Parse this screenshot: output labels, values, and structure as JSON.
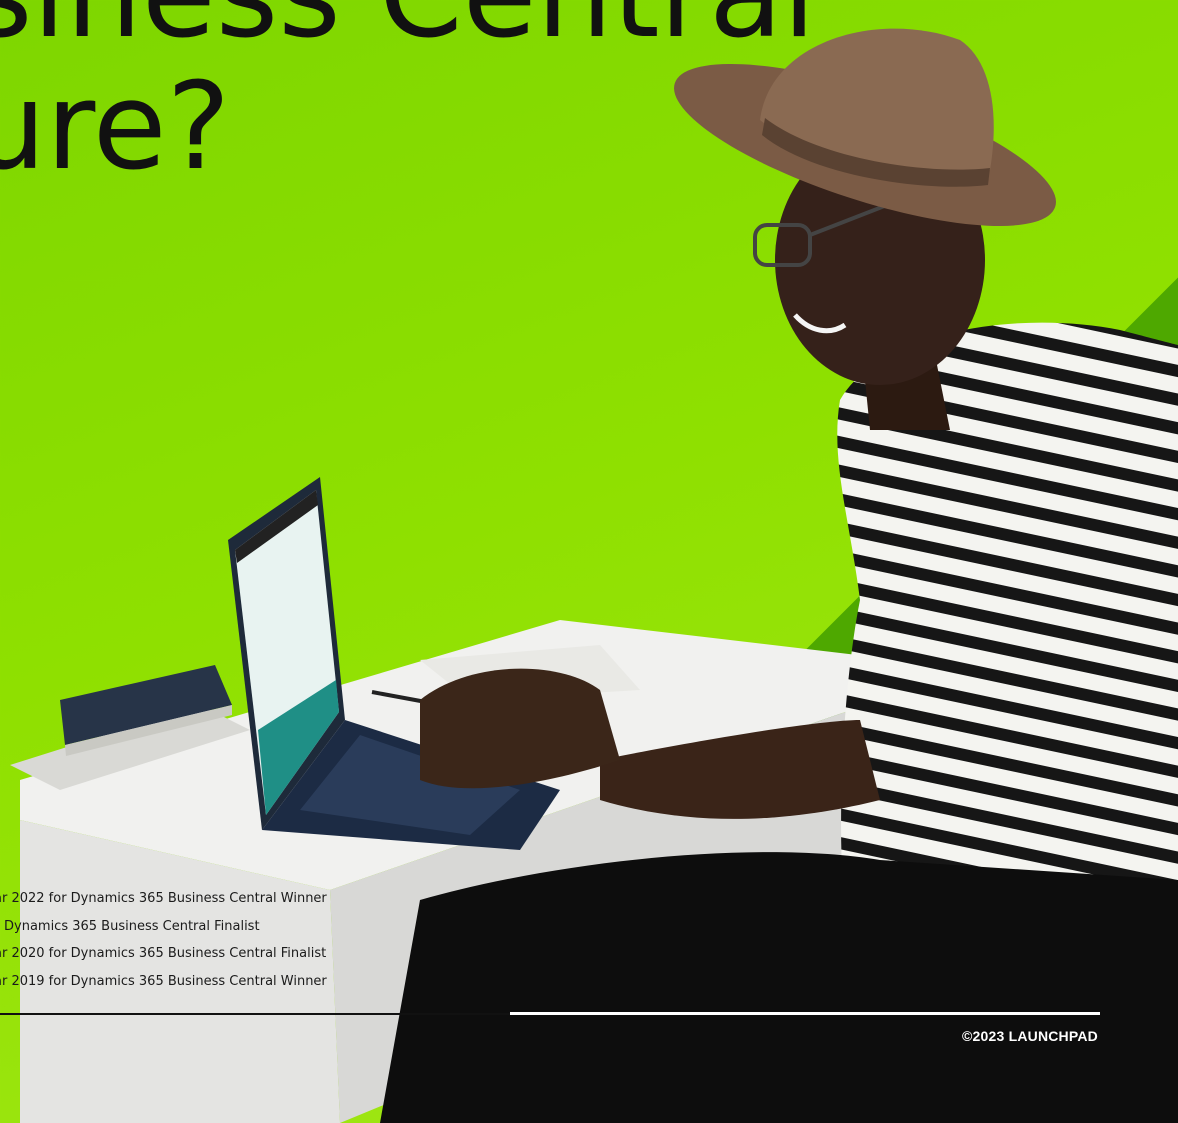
{
  "headline": {
    "line1": "siness Central",
    "line2": "ure?"
  },
  "awards": [
    "ar 2022 for Dynamics 365 Business Central Winner",
    "Dynamics 365 Business Central Finalist",
    "ar 2020 for Dynamics 365 Business Central Finalist",
    "ar 2019 for Dynamics 365 Business Central Winner"
  ],
  "footer": {
    "copyright": "©2023 LAUNCHPAD"
  },
  "colors": {
    "background_green": "#8fe000",
    "stripe_dark": "#3f9f00",
    "stripe_light": "#a9e92e",
    "text": "#111111"
  }
}
